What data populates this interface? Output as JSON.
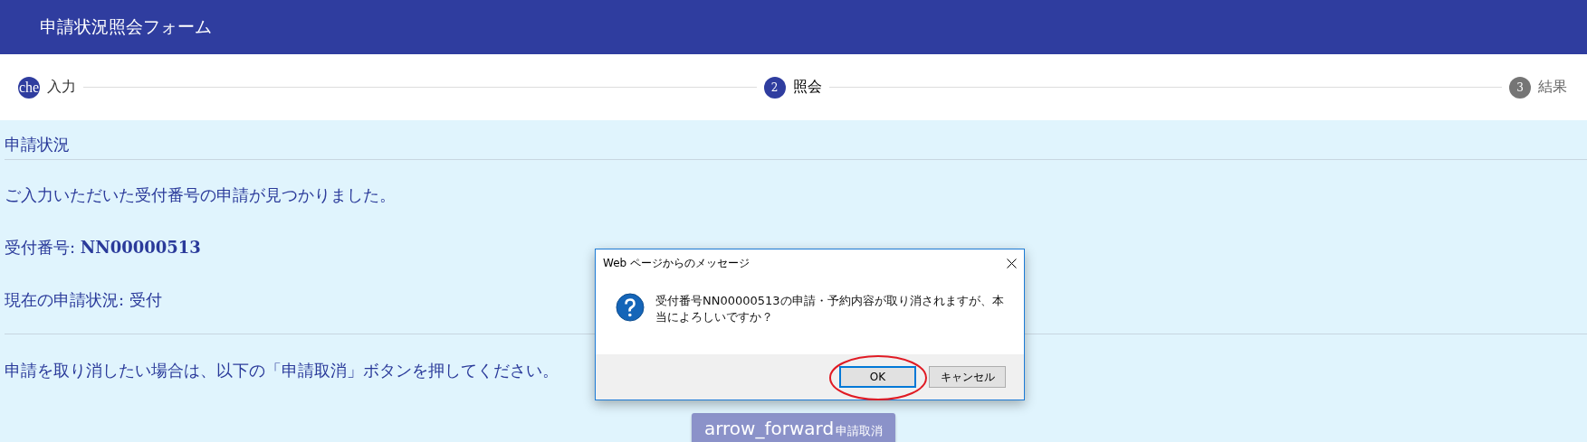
{
  "header": {
    "title": "申請状況照会フォーム"
  },
  "steps": [
    {
      "marker": "che",
      "label": "入力",
      "completed": true,
      "selected": false
    },
    {
      "marker": "2",
      "label": "照会",
      "completed": false,
      "selected": true
    },
    {
      "marker": "3",
      "label": "結果",
      "completed": false,
      "selected": false
    }
  ],
  "panel": {
    "heading": "申請状況",
    "message": "ご入力いただいた受付番号の申請が見つかりました。",
    "fields": [
      {
        "label": "受付番号:",
        "value": "NN00000513",
        "kind": "bold"
      },
      {
        "label": "現在の申請状況:",
        "value": "受付",
        "kind": "plain"
      }
    ],
    "instruction": "申請を取り消したい場合は、以下の「申請取消」ボタンを押してください。",
    "button": {
      "icon_text": "arrow_forward",
      "label": "申請取消",
      "disabled": true
    }
  },
  "dialog": {
    "title": "Web ページからのメッセージ",
    "message": "受付番号NN00000513の申請・予約内容が取り消されますが、本当によろしいですか？",
    "buttons": [
      {
        "label": "OK",
        "selected": true,
        "highlighted": true
      },
      {
        "label": "キャンセル",
        "selected": false,
        "highlighted": false
      }
    ]
  }
}
